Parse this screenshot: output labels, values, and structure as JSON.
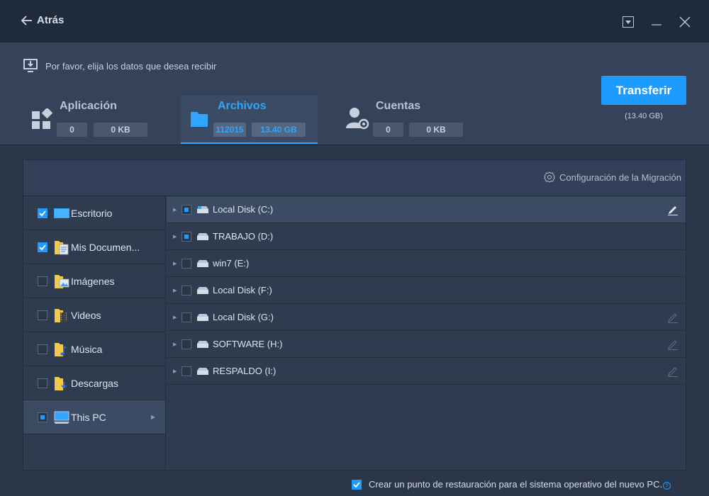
{
  "titlebar": {
    "back_label": "Atrás"
  },
  "header": {
    "prompt": "Por favor, elija los datos que desea recibir",
    "tabs": [
      {
        "title": "Aplicación",
        "count": "0",
        "size": "0 KB",
        "active": false
      },
      {
        "title": "Archivos",
        "count": "112015",
        "size": "13.40 GB",
        "active": true
      },
      {
        "title": "Cuentas",
        "count": "0",
        "size": "0 KB",
        "active": false
      }
    ],
    "transfer_label": "Transferir",
    "transfer_size": "(13.40 GB)"
  },
  "panel": {
    "migration_label": "Configuración de la Migración",
    "folders": [
      {
        "label": "Escritorio",
        "state": "checked",
        "icon": "desktop-folder-icon"
      },
      {
        "label": "Mis Documen...",
        "state": "checked",
        "icon": "documents-folder-icon"
      },
      {
        "label": "Imágenes",
        "state": "unchecked",
        "icon": "pictures-folder-icon"
      },
      {
        "label": "Videos",
        "state": "unchecked",
        "icon": "videos-folder-icon"
      },
      {
        "label": "Música",
        "state": "unchecked",
        "icon": "music-folder-icon"
      },
      {
        "label": "Descargas",
        "state": "unchecked",
        "icon": "downloads-folder-icon"
      },
      {
        "label": "This PC",
        "state": "partial",
        "icon": "this-pc-icon"
      }
    ],
    "drives": [
      {
        "label": "Local Disk (C:)",
        "state": "partial",
        "edit": "active"
      },
      {
        "label": "TRABAJO (D:)",
        "state": "partial",
        "edit": "none"
      },
      {
        "label": "win7 (E:)",
        "state": "unchecked",
        "edit": "none"
      },
      {
        "label": "Local Disk (F:)",
        "state": "unchecked",
        "edit": "none"
      },
      {
        "label": "Local Disk (G:)",
        "state": "unchecked",
        "edit": "dim"
      },
      {
        "label": "SOFTWARE (H:)",
        "state": "unchecked",
        "edit": "dim"
      },
      {
        "label": "RESPALDO (I:)",
        "state": "unchecked",
        "edit": "dim"
      }
    ]
  },
  "footer": {
    "restore_label": "Crear un punto de restauración para el sistema operativo del nuevo PC.",
    "help_label": "?"
  },
  "colors": {
    "accent": "#1e9bff",
    "titlebar_bg": "#1f2a3b",
    "body_bg": "#2b3648"
  }
}
